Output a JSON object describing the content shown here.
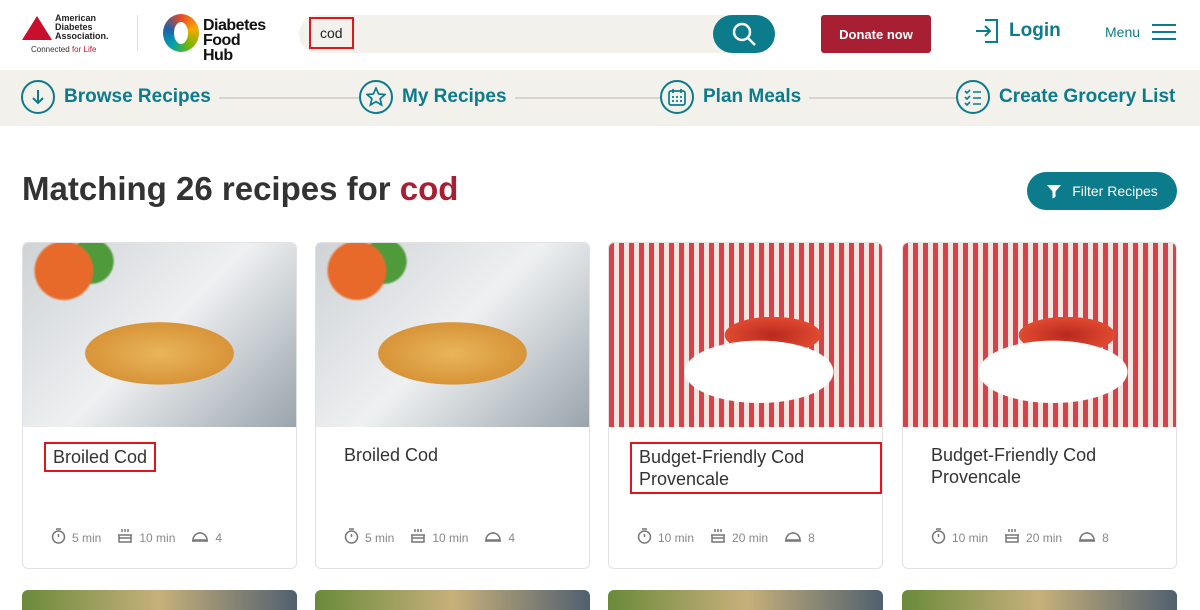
{
  "header": {
    "ada_logo": {
      "lines": [
        "American",
        "Diabetes",
        "Association."
      ],
      "tagline_a": "Connected",
      "tagline_b": "for Life"
    },
    "dfh_logo": {
      "line1": "Diabetes",
      "line2": "Food Hub"
    },
    "search_value": "cod",
    "donate_label": "Donate now",
    "login_label": "Login",
    "menu_label": "Menu"
  },
  "nav": [
    {
      "label": "Browse Recipes",
      "icon": "arrow-down-circle-icon"
    },
    {
      "label": "My Recipes",
      "icon": "star-icon"
    },
    {
      "label": "Plan Meals",
      "icon": "calendar-icon"
    },
    {
      "label": "Create Grocery List",
      "icon": "checklist-icon"
    }
  ],
  "results": {
    "prefix": "Matching 26 recipes for",
    "term": "cod",
    "filter_label": "Filter Recipes"
  },
  "cards": [
    {
      "title": "Broiled Cod",
      "prep": "5 min",
      "cook": "10 min",
      "servings": "4",
      "highlighted": true
    },
    {
      "title": "Broiled Cod",
      "prep": "5 min",
      "cook": "10 min",
      "servings": "4",
      "highlighted": false
    },
    {
      "title": "Budget-Friendly Cod Provencale",
      "prep": "10 min",
      "cook": "20 min",
      "servings": "8",
      "highlighted": true
    },
    {
      "title": "Budget-Friendly Cod Provencale",
      "prep": "10 min",
      "cook": "20 min",
      "servings": "8",
      "highlighted": false
    }
  ],
  "colors": {
    "teal": "#0c7b8c",
    "brand_red": "#a81e32",
    "highlight": "#e0161e"
  }
}
